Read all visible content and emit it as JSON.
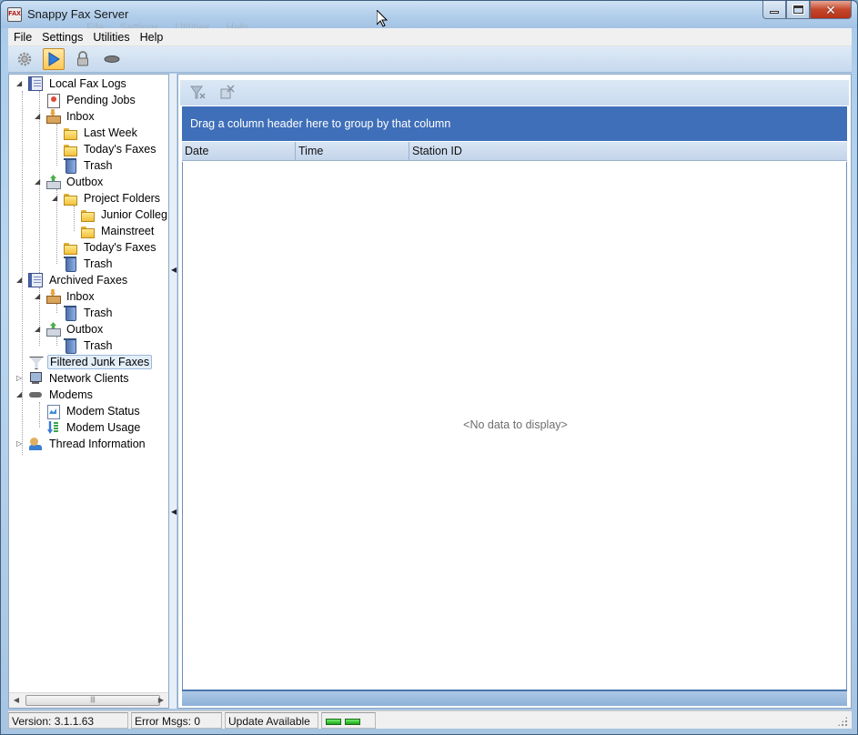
{
  "window": {
    "title": "Snappy Fax Server",
    "ghost_menu": "File Settings Utilities Help",
    "app_icon_text": "FAX"
  },
  "menubar": {
    "items": [
      "File",
      "Settings",
      "Utilities",
      "Help"
    ]
  },
  "toolbar": {
    "buttons": [
      {
        "icon": "gear-icon",
        "active": false
      },
      {
        "icon": "play-icon",
        "active": true
      },
      {
        "icon": "lock-icon",
        "active": false
      },
      {
        "icon": "modem-icon",
        "active": false
      }
    ]
  },
  "tree": {
    "local_fax_logs": "Local Fax Logs",
    "pending_jobs": "Pending Jobs",
    "inbox": "Inbox",
    "last_week": "Last Week",
    "todays_faxes": "Today's Faxes",
    "trash": "Trash",
    "outbox": "Outbox",
    "project_folders": "Project Folders",
    "junior_college": "Junior Colleg",
    "mainstreet": "Mainstreet",
    "archived_faxes": "Archived Faxes",
    "filtered_junk_faxes": "Filtered Junk Faxes",
    "network_clients": "Network Clients",
    "modems": "Modems",
    "modem_status": "Modem  Status",
    "modem_usage": "Modem  Usage",
    "thread_information": "Thread Information",
    "selected": "Filtered Junk Faxes"
  },
  "grid": {
    "group_hint": "Drag a column header here to group by that column",
    "columns": [
      "Date",
      "Time",
      "Station ID"
    ],
    "empty_text": "<No data to display>"
  },
  "statusbar": {
    "version": "Version: 3.1.1.63",
    "error_msgs": "Error Msgs: 0",
    "update": "Update Available"
  },
  "colors": {
    "group_bar": "#3f6fb8",
    "led_on": "#2fcf2a",
    "selection": "#e3eef9"
  }
}
